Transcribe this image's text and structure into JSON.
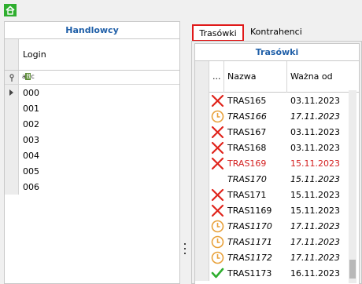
{
  "toolbar": {
    "home_icon": "home-icon",
    "color": "#2fae2f"
  },
  "left_grid": {
    "title": "Handlowcy",
    "column_header": "Login",
    "filter_icon": "abc-filter-icon",
    "rows": [
      "000",
      "001",
      "002",
      "003",
      "004",
      "005",
      "006"
    ],
    "selected_row": 0
  },
  "tabs": [
    {
      "label": "Trasówki",
      "active": true
    },
    {
      "label": "Kontrahenci",
      "active": false
    }
  ],
  "right_grid": {
    "title": "Trasówki",
    "columns": [
      "...",
      "Nazwa",
      "Ważna od"
    ],
    "rows": [
      {
        "icon": "red-x-icon",
        "name": "TRAS165",
        "date": "03.11.2023",
        "italic": false,
        "red": false
      },
      {
        "icon": "clock-icon",
        "name": "TRAS166",
        "date": "17.11.2023",
        "italic": true,
        "red": false
      },
      {
        "icon": "red-x-icon",
        "name": "TRAS167",
        "date": "03.11.2023",
        "italic": false,
        "red": false
      },
      {
        "icon": "red-x-icon",
        "name": "TRAS168",
        "date": "03.11.2023",
        "italic": false,
        "red": false
      },
      {
        "icon": "red-x-icon",
        "name": "TRAS169",
        "date": "15.11.2023",
        "italic": false,
        "red": true
      },
      {
        "icon": "none",
        "name": "TRAS170",
        "date": "15.11.2023",
        "italic": true,
        "red": false
      },
      {
        "icon": "red-x-icon",
        "name": "TRAS171",
        "date": "15.11.2023",
        "italic": false,
        "red": false
      },
      {
        "icon": "red-x-icon",
        "name": "TRAS1169",
        "date": "15.11.2023",
        "italic": false,
        "red": false
      },
      {
        "icon": "clock-icon",
        "name": "TRAS1170",
        "date": "17.11.2023",
        "italic": true,
        "red": false
      },
      {
        "icon": "clock-icon",
        "name": "TRAS1171",
        "date": "17.11.2023",
        "italic": true,
        "red": false
      },
      {
        "icon": "clock-icon",
        "name": "TRAS1172",
        "date": "17.11.2023",
        "italic": true,
        "red": false
      },
      {
        "icon": "green-check-icon",
        "name": "TRAS1173",
        "date": "16.11.2023",
        "italic": false,
        "red": false
      }
    ]
  },
  "colors": {
    "title_blue": "#1f5fa8",
    "active_tab_border": "#e01818",
    "x_red": "#e0241c",
    "clock_orange": "#e8a13a",
    "check_green": "#2fae2f"
  }
}
